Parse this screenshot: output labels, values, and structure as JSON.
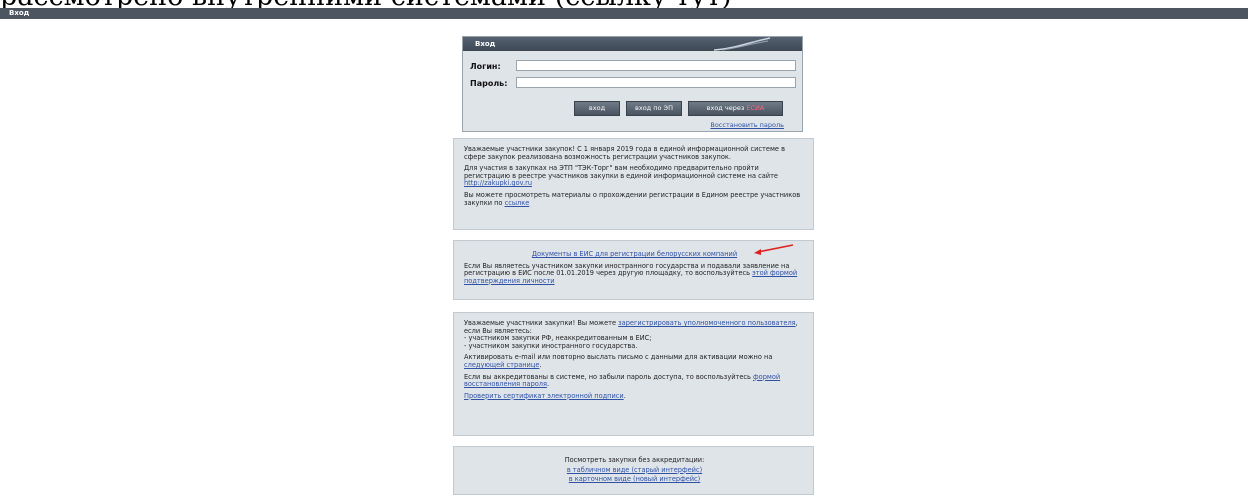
{
  "caption": {
    "text": "рассмотрено внутренними системами (ссылку тут)"
  },
  "topbar": {
    "title": "Вход"
  },
  "login": {
    "header": "Вход",
    "login_label": "Логин:",
    "password_label": "Пароль:",
    "login_value": "",
    "password_value": "",
    "btn_login": "вход",
    "btn_login_ep": "вход по ЭП",
    "btn_via_prefix": "вход через ",
    "btn_via_suffix": "ЕСИА",
    "restore_link": "Восстановить пароль"
  },
  "panel1": {
    "p1": "Уважаемые участники закупок! С 1 января 2019 года в единой информационной системе в сфере закупок реализована возможность регистрации участников закупок.",
    "p2_text": "Для участия в закупках на ЭТП \"ТЭК-Торг\" вам необходимо предварительно пройти регистрацию в реестре участников закупки в единой информационной системе на сайте",
    "p2_link": "http://zakupki.gov.ru",
    "p3_text": "Вы можете просмотреть материалы о прохождении регистрации в Едином реестре участников закупки по",
    "p3_link": "ссылке"
  },
  "panel2": {
    "docs_link": "Документы в ЕИС для регистрации белорусских компаний",
    "p_text": "Если Вы являетесь участником закупки иностранного государства и подавали заявление на регистрацию в ЕИС после 01.01.2019 через другую площадку, то воспользуйтесь",
    "p_link": "этой формой подтверждения личности"
  },
  "panel3": {
    "p1_a": "Уважаемые участники закупки! Вы можете",
    "p1_link": "зарегистрировать уполномоченного пользователя",
    "p1_b": ", если Вы являетесь:",
    "p1_li1": "- участником закупки РФ, неаккредитованным в ЕИС;",
    "p1_li2": "- участником закупки иностранного государства.",
    "p2_a": "Активировать e-mail или повторно выслать письмо с данными для активации можно на",
    "p2_link": "следующей странице",
    "p3_a": "Если вы аккредитованы в системе, но забыли пароль доступа, то воспользуйтесь",
    "p3_link": "формой восстановления пароля",
    "p4_link": "Проверить сертификат электронной подписи"
  },
  "panel4": {
    "title": "Посмотреть закупки без аккредитации:",
    "link1": "в табличном виде (старый интерфейс)",
    "link2": "в карточном виде (новый интерфейс)"
  },
  "colors": {
    "accent_link": "#2f52a6",
    "header_bg": "#4d5560",
    "panel_bg": "#dfe4e9",
    "annotation_arrow": "#e02020"
  }
}
